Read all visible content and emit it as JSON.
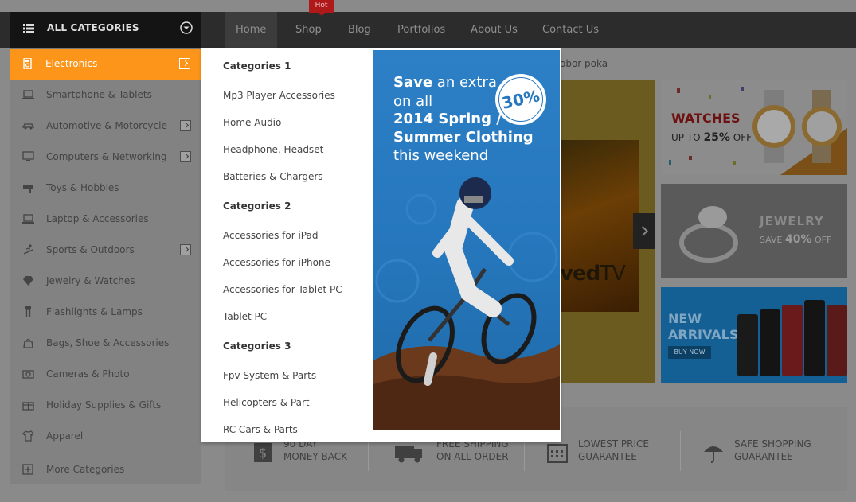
{
  "nav": {
    "categories_title": "ALL CATEGORIES",
    "items": [
      "Home",
      "Shop",
      "Blog",
      "Portfolios",
      "About Us",
      "Contact Us"
    ],
    "active": "Home",
    "hot_badge": "Hot"
  },
  "sidebar": {
    "items": [
      {
        "label": "Electronics",
        "icon": "mp3-player-icon",
        "has_submenu": true,
        "selected": true
      },
      {
        "label": "Smartphone & Tablets",
        "icon": "laptop-icon",
        "has_submenu": false
      },
      {
        "label": "Automotive & Motorcycle",
        "icon": "car-icon",
        "has_submenu": true
      },
      {
        "label": "Computers & Networking",
        "icon": "monitor-icon",
        "has_submenu": true
      },
      {
        "label": "Toys & Hobbies",
        "icon": "toy-gun-icon",
        "has_submenu": false
      },
      {
        "label": "Laptop & Accessories",
        "icon": "laptop-icon",
        "has_submenu": false
      },
      {
        "label": "Sports & Outdoors",
        "icon": "skier-icon",
        "has_submenu": true
      },
      {
        "label": "Jewelry & Watches",
        "icon": "diamond-icon",
        "has_submenu": false
      },
      {
        "label": "Flashlights & Lamps",
        "icon": "flashlight-icon",
        "has_submenu": false
      },
      {
        "label": "Bags, Shoe & Accessories",
        "icon": "bag-icon",
        "has_submenu": false
      },
      {
        "label": "Cameras & Photo",
        "icon": "camera-icon",
        "has_submenu": false
      },
      {
        "label": "Holiday Supplies & Gifts",
        "icon": "gift-icon",
        "has_submenu": false
      },
      {
        "label": "Apparel",
        "icon": "shirt-icon",
        "has_submenu": false
      }
    ],
    "more": "More Categories"
  },
  "dropdown": {
    "groups": [
      {
        "title": "Categories 1",
        "links": [
          "Mp3 Player Accessories",
          "Home Audio",
          "Headphone, Headset",
          "Batteries & Chargers"
        ]
      },
      {
        "title": "Categories 2",
        "links": [
          "Accessories for iPad",
          "Accessories for iPhone",
          "Accessories for Tablet PC",
          "Tablet PC"
        ]
      },
      {
        "title": "Categories 3",
        "links": [
          "Fpv System & Parts",
          "Helicopters & Part",
          "RC Cars & Parts"
        ]
      }
    ],
    "ad": {
      "save": "Save",
      "an_extra": " an extra",
      "on_all": "on all",
      "line3": "2014 Spring /",
      "line4": "Summer Clothing",
      "line5": "this weekend",
      "badge": "30%"
    }
  },
  "background": {
    "breadcrumb": "obor poka",
    "tv_text_bold": "ved",
    "tv_text_light": "TV",
    "watches": {
      "title": "WATCHES",
      "sub_prefix": "UP TO ",
      "sub_value": "25%",
      "sub_suffix": " OFF"
    },
    "jewelry": {
      "title": "JEWELRY",
      "sub_prefix": "SAVE ",
      "sub_value": "40%",
      "sub_suffix": " OFF"
    },
    "arrivals": {
      "line1": "NEW",
      "line2": "ARRIVALS",
      "button": "BUY NOW"
    },
    "services": [
      {
        "line1": "90 DAY",
        "line2": "MONEY BACK",
        "icon": "money-back-icon"
      },
      {
        "line1": "FREE SHIPPING",
        "line2": "ON ALL ORDER",
        "icon": "truck-icon"
      },
      {
        "line1": "LOWEST PRICE",
        "line2": "GUARANTEE",
        "icon": "calendar-icon"
      },
      {
        "line1": "SAFE SHOPPING",
        "line2": "GUARANTEE",
        "icon": "umbrella-icon"
      }
    ]
  },
  "colors": {
    "accent": "#fc951a",
    "hot": "#b01919",
    "ad_blue": "#2677bd"
  }
}
